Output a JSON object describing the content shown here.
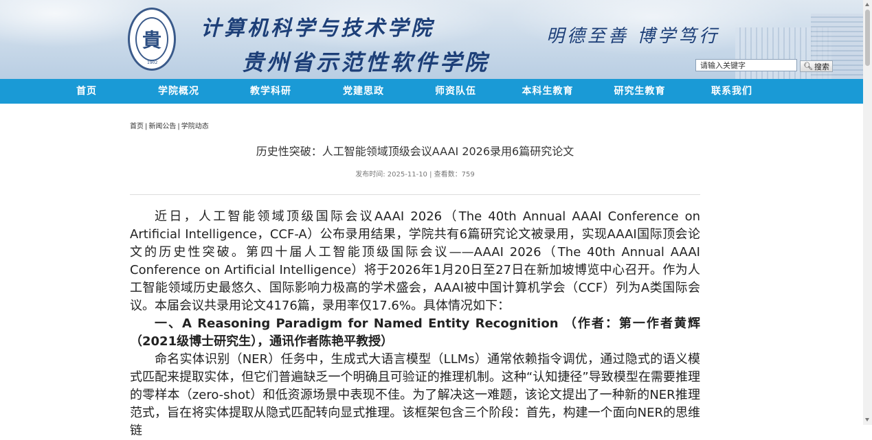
{
  "header": {
    "title_line1": "计算机科学与技术学院",
    "title_line2": "贵州省示范性软件学院",
    "motto": "明德至善 博学笃行",
    "logo_text": "貴",
    "logo_year": "1902",
    "search_placeholder": "请输入关键字",
    "search_button": "搜索"
  },
  "nav": {
    "items": [
      "首页",
      "学院概况",
      "教学科研",
      "党建思政",
      "师资队伍",
      "本科生教育",
      "研究生教育",
      "联系我们"
    ]
  },
  "breadcrumb": {
    "items": [
      "首页",
      "新闻公告",
      "学院动态"
    ],
    "separator": "|"
  },
  "article": {
    "title": "历史性突破：人工智能领域顶级会议AAAI 2026录用6篇研究论文",
    "meta": "发布时间:   2025-11-10 | 查看数：759",
    "paragraphs": [
      "近日，人工智能领域顶级国际会议AAAI 2026（The 40th Annual AAAI Conference on Artificial Intelligence，CCF-A）公布录用结果，学院共有6篇研究论文被录用，实现AAAI国际顶会论文的历史性突破。第四十届人工智能顶级国际会议——AAAI 2026（The 40th Annual AAAI Conference on Artificial Intelligence）将于2026年1月20日至27日在新加坡博览中心召开。作为人工智能领域历史最悠久、国际影响力极高的学术盛会，AAAI被中国计算机学会（CCF）列为A类国际会议。本届会议共录用论文4176篇，录用率仅17.6%。具体情况如下：",
      "一、A Reasoning Paradigm for Named Entity Recognition （作者：第一作者黄辉（2021级博士研究生），通讯作者陈艳平教授）",
      "命名实体识别（NER）任务中，生成式大语言模型（LLMs）通常依赖指令调优，通过隐式的语义模式匹配来提取实体，但它们普遍缺乏一个明确且可验证的推理机制。这种“认知捷径”导致模型在需要推理的零样本（zero-shot）和低资源场景中表现不佳。为了解决这一难题，该论文提出了一种新的NER推理范式，旨在将实体提取从隐式匹配转向显式推理。该框架包含三个阶段：首先，构建一个面向NER的思维链"
    ]
  }
}
